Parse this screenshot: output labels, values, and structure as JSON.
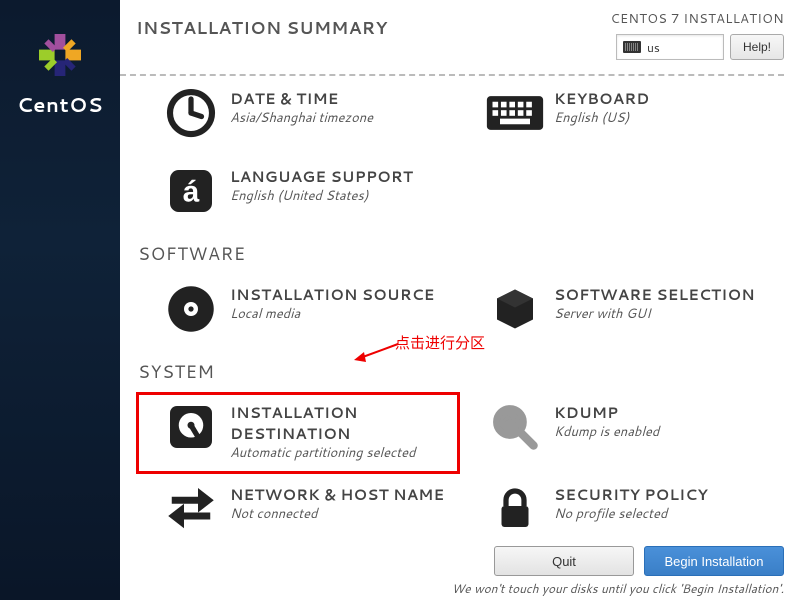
{
  "sidebar": {
    "brand": "CentOS"
  },
  "header": {
    "title": "INSTALLATION SUMMARY",
    "subtitle": "CENTOS 7 INSTALLATION",
    "lang_indicator": "us",
    "help_label": "Help!"
  },
  "sections": {
    "software_label": "SOFTWARE",
    "system_label": "SYSTEM"
  },
  "spokes": {
    "datetime": {
      "title": "DATE & TIME",
      "sub": "Asia/Shanghai timezone"
    },
    "keyboard": {
      "title": "KEYBOARD",
      "sub": "English (US)"
    },
    "language": {
      "title": "LANGUAGE SUPPORT",
      "sub": "English (United States)"
    },
    "source": {
      "title": "INSTALLATION SOURCE",
      "sub": "Local media"
    },
    "swselect": {
      "title": "SOFTWARE SELECTION",
      "sub": "Server with GUI"
    },
    "dest": {
      "title": "INSTALLATION DESTINATION",
      "sub": "Automatic partitioning selected"
    },
    "kdump": {
      "title": "KDUMP",
      "sub": "Kdump is enabled"
    },
    "network": {
      "title": "NETWORK & HOST NAME",
      "sub": "Not connected"
    },
    "security": {
      "title": "SECURITY POLICY",
      "sub": "No profile selected"
    }
  },
  "footer": {
    "quit_label": "Quit",
    "begin_label": "Begin Installation",
    "note": "We won't touch your disks until you click 'Begin Installation'."
  },
  "annotation": {
    "text": "点击进行分区"
  }
}
